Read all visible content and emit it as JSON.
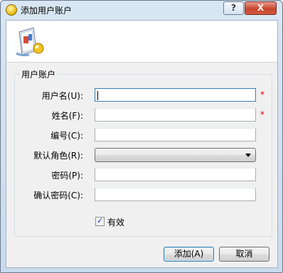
{
  "window": {
    "title": "添加用户账户",
    "help_glyph": "?",
    "close_glyph": "X"
  },
  "group": {
    "title": "用户账户"
  },
  "fields": [
    {
      "label": "用户名(U):",
      "value": "",
      "required": "*"
    },
    {
      "label": "姓名(F):",
      "value": "",
      "required": "*"
    },
    {
      "label": "编号(C):",
      "value": ""
    },
    {
      "label": "默认角色(R):",
      "value": ""
    },
    {
      "label": "密码(P):",
      "value": ""
    },
    {
      "label": "确认密码(C):",
      "value": ""
    }
  ],
  "checkbox": {
    "label": "有效",
    "checked": true,
    "mark": "✓"
  },
  "buttons": {
    "add": "添加(A)",
    "cancel": "取消"
  },
  "icons": {
    "app": "app-icon",
    "banner": "user-account-icon"
  }
}
